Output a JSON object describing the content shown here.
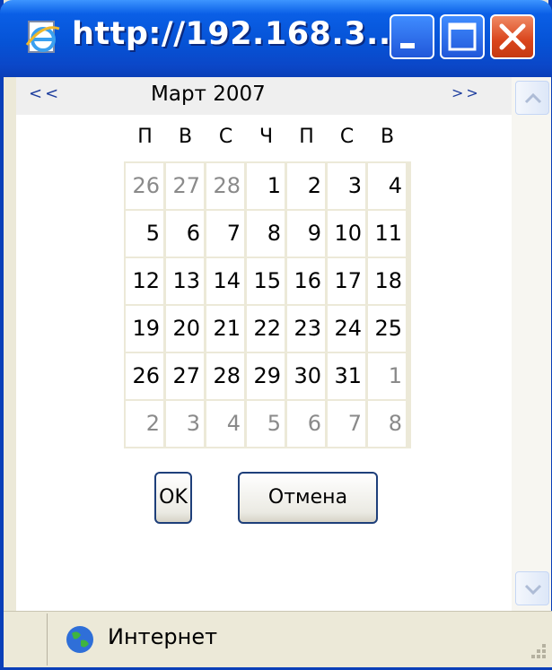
{
  "window": {
    "title": "http://192.168.3....",
    "icon": "ie-page-icon",
    "controls": [
      "minimize-icon",
      "maximize-icon",
      "close-icon"
    ]
  },
  "calendar": {
    "prev_label": "<<",
    "next_label": ">>",
    "month_label": "Март 2007",
    "weekdays": [
      "П",
      "В",
      "С",
      "Ч",
      "П",
      "С",
      "В"
    ],
    "weeks": [
      [
        {
          "d": "26",
          "o": true
        },
        {
          "d": "27",
          "o": true
        },
        {
          "d": "28",
          "o": true
        },
        {
          "d": "1"
        },
        {
          "d": "2"
        },
        {
          "d": "3"
        },
        {
          "d": "4"
        }
      ],
      [
        {
          "d": "5"
        },
        {
          "d": "6"
        },
        {
          "d": "7"
        },
        {
          "d": "8"
        },
        {
          "d": "9"
        },
        {
          "d": "10"
        },
        {
          "d": "11"
        }
      ],
      [
        {
          "d": "12"
        },
        {
          "d": "13"
        },
        {
          "d": "14"
        },
        {
          "d": "15"
        },
        {
          "d": "16"
        },
        {
          "d": "17"
        },
        {
          "d": "18"
        }
      ],
      [
        {
          "d": "19"
        },
        {
          "d": "20"
        },
        {
          "d": "21"
        },
        {
          "d": "22"
        },
        {
          "d": "23"
        },
        {
          "d": "24"
        },
        {
          "d": "25"
        }
      ],
      [
        {
          "d": "26"
        },
        {
          "d": "27"
        },
        {
          "d": "28"
        },
        {
          "d": "29"
        },
        {
          "d": "30"
        },
        {
          "d": "31"
        },
        {
          "d": "1",
          "o": true
        }
      ],
      [
        {
          "d": "2",
          "o": true
        },
        {
          "d": "3",
          "o": true
        },
        {
          "d": "4",
          "o": true
        },
        {
          "d": "5",
          "o": true
        },
        {
          "d": "6",
          "o": true
        },
        {
          "d": "7",
          "o": true
        },
        {
          "d": "8",
          "o": true
        }
      ]
    ]
  },
  "buttons": {
    "ok": "OK",
    "cancel": "Отмена"
  },
  "status": {
    "zone": "Интернет",
    "icon": "globe-icon"
  },
  "colors": {
    "titlebar": "#0653d6",
    "close": "#d9441b",
    "nav_link": "#1e3e9e",
    "other_month": "#8a8a8a",
    "grid_border": "#ece9d8"
  }
}
